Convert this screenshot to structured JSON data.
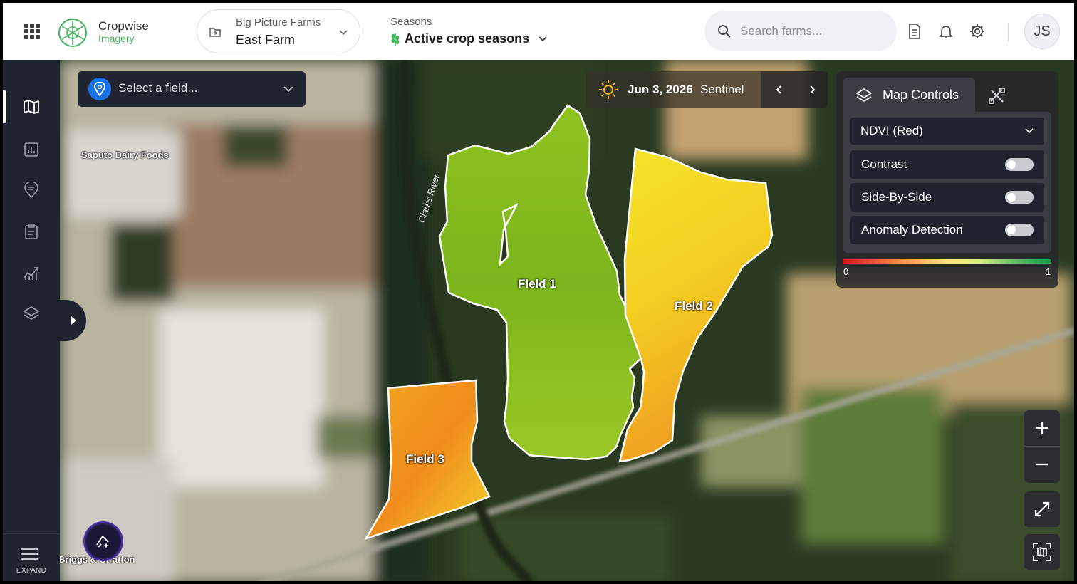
{
  "header": {
    "apps_icon": "grid-icon",
    "brand_name": "Cropwise",
    "brand_product": "Imagery",
    "farm": {
      "organization": "Big Picture Farms",
      "name": "East Farm"
    },
    "seasons": {
      "label": "Seasons",
      "value": "Active crop seasons"
    },
    "search": {
      "placeholder": "Search farms..."
    },
    "icons": [
      "document-icon",
      "bell-icon",
      "gear-icon"
    ],
    "avatar_initials": "JS"
  },
  "sidebar": {
    "items": [
      {
        "name": "map",
        "icon": "map-icon",
        "active": true
      },
      {
        "name": "reports",
        "icon": "chart-icon",
        "active": false
      },
      {
        "name": "notes",
        "icon": "note-pin-icon",
        "active": false
      },
      {
        "name": "tasks",
        "icon": "clipboard-icon",
        "active": false
      },
      {
        "name": "analytics",
        "icon": "trend-icon",
        "active": false
      },
      {
        "name": "layers",
        "icon": "layers-icon",
        "active": false
      }
    ],
    "expand_label": "EXPAND"
  },
  "map": {
    "field_select_placeholder": "Select a field...",
    "date": "Jun 3, 2026",
    "source": "Sentinel",
    "fields": [
      {
        "label": "Field 1",
        "ndvi_color": "#84b820"
      },
      {
        "label": "Field 2",
        "ndvi_color": "#f0d628"
      },
      {
        "label": "Field 3",
        "ndvi_color": "#f29420"
      }
    ],
    "poi_labels": [
      "Saputo Dairy Foods",
      "Briggs & Stratton"
    ],
    "river_label": "Clarks River"
  },
  "map_controls": {
    "tab_label": "Map Controls",
    "layer": "NDVI (Red)",
    "toggles": [
      {
        "label": "Contrast",
        "on": false
      },
      {
        "label": "Side-By-Side",
        "on": false
      },
      {
        "label": "Anomaly Detection",
        "on": false
      }
    ],
    "legend_min": "0",
    "legend_max": "1"
  },
  "colors": {
    "brand_green": "#43b35e",
    "sidebar_bg": "#1f2430",
    "accent_blue": "#1a73e8"
  }
}
